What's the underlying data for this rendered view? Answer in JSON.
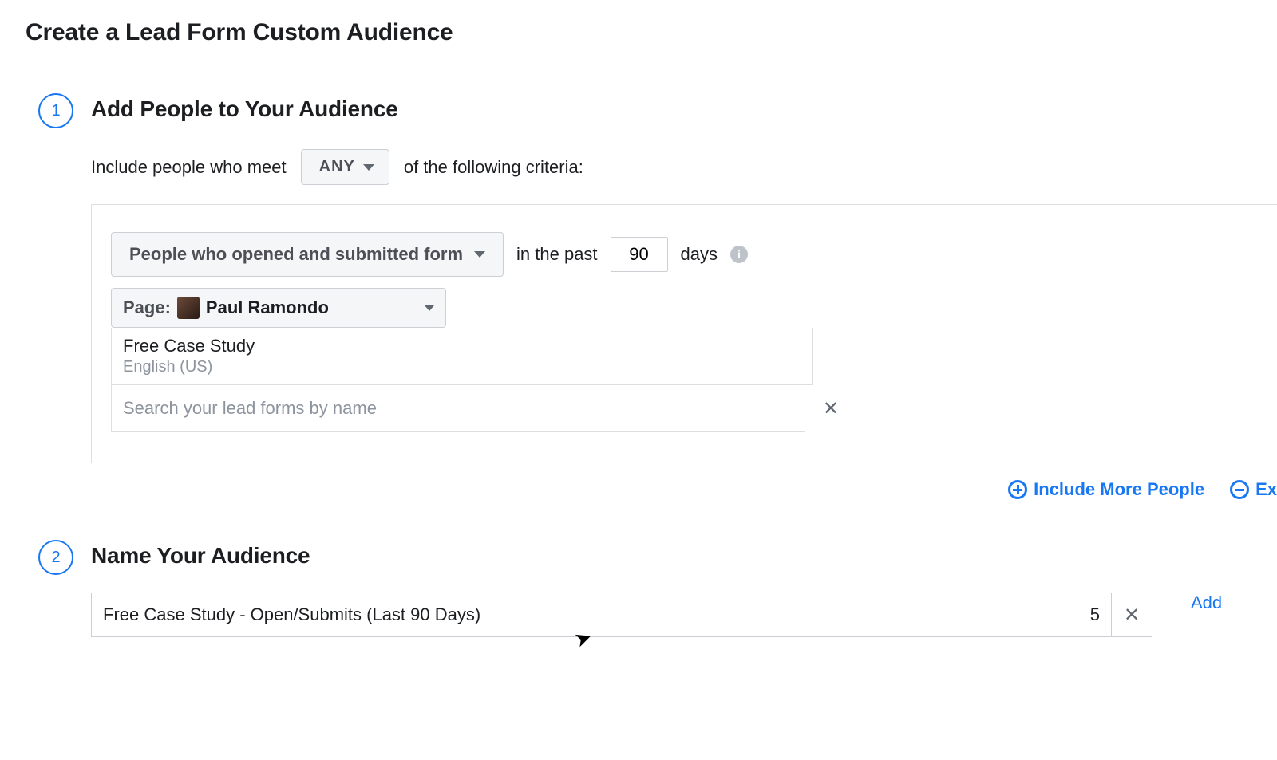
{
  "title": "Create a Lead Form Custom Audience",
  "step1": {
    "number": "1",
    "heading": "Add People to Your Audience",
    "include_prefix": "Include people who meet",
    "any_label": "ANY",
    "include_suffix": "of the following criteria:",
    "engagement_label": "People who opened and submitted form",
    "past_prefix": "in the past",
    "days_value": "90",
    "days_label": "days",
    "page_prefix": "Page:",
    "page_name": "Paul Ramondo",
    "form_name": "Free Case Study",
    "form_locale": "English (US)",
    "search_placeholder": "Search your lead forms by name",
    "include_more": "Include More People",
    "exclude_label": "Ex"
  },
  "step2": {
    "number": "2",
    "heading": "Name Your Audience",
    "name_value": "Free Case Study - Open/Submits (Last 90 Days)",
    "char_remaining": "5",
    "add_desc": "Add"
  }
}
